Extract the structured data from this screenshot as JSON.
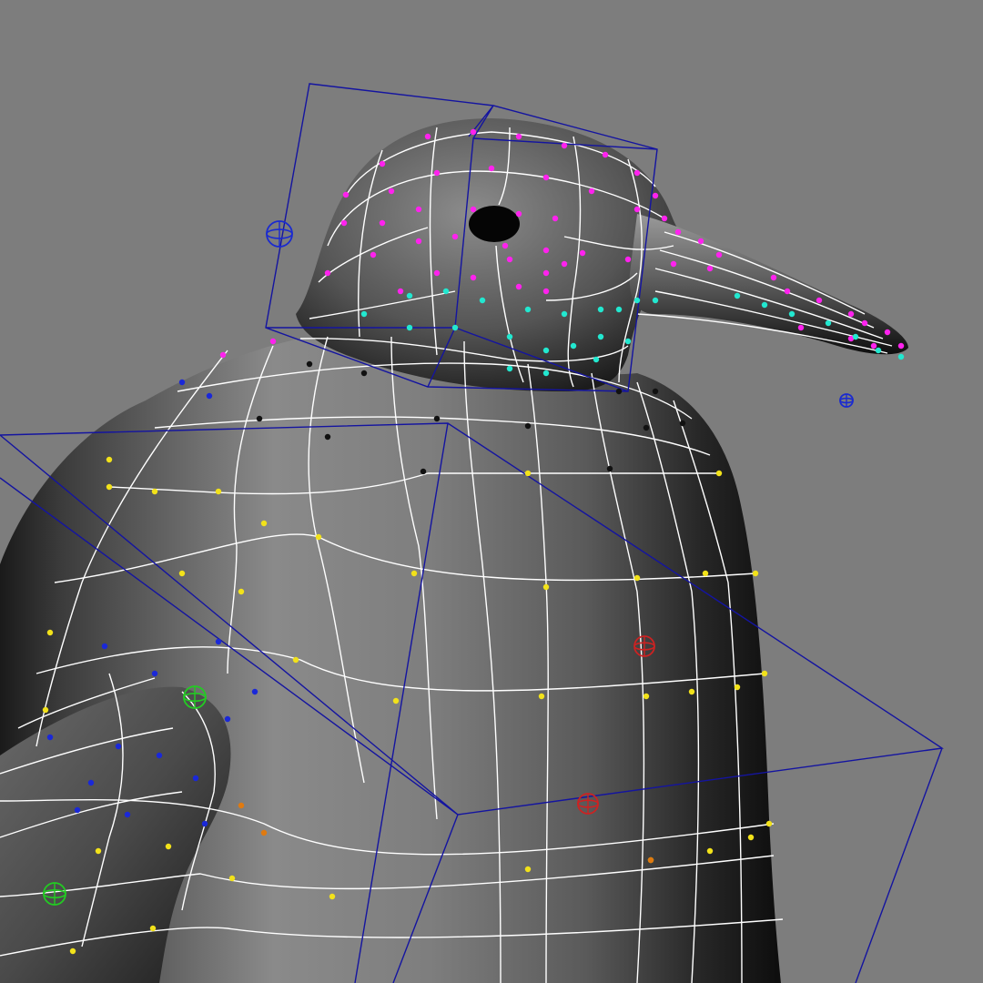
{
  "viewport": {
    "background": "#7d7d7d",
    "model": "penguin-mesh",
    "colors": {
      "wireframe": "#ffffff",
      "lattice": "#1414a0",
      "cluster_head": "#ff22ee",
      "cluster_neck": "#22e8d0",
      "cluster_body": "#f2e21a",
      "cluster_flipper": "#1a28d8",
      "cluster_collar": "#111111",
      "cluster_detail": "#e07a10",
      "handle_green": "#22cc22",
      "handle_red": "#cc2222",
      "handle_blue": "#1a2ad0"
    },
    "components": [
      "head",
      "beak",
      "eye",
      "neck",
      "body",
      "flipper",
      "head-lattice",
      "body-lattice"
    ],
    "handles": [
      "head-joint-handle",
      "beak-locator-handle",
      "body-pivot-handle",
      "body-lower-handle",
      "flipper-handle-upper",
      "flipper-handle-lower"
    ]
  }
}
